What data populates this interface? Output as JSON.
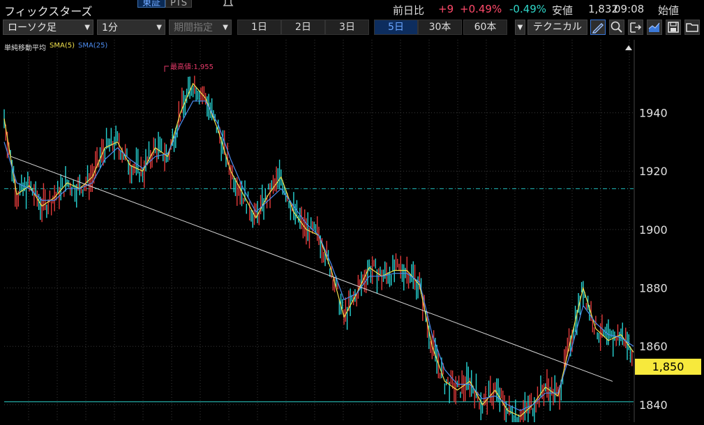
{
  "header": {
    "title": "フィックスターズ",
    "exchange_tabs": [
      "東証",
      "PTS"
    ],
    "quote": {
      "prev_label": "前日比",
      "change": "+9",
      "change_pct": "+0.49%",
      "other_pct": "-0.49%",
      "low_label": "安値",
      "low_value": "1,832",
      "time": "09:08",
      "open_label": "始値"
    }
  },
  "toolbar": {
    "chart_type": "ローソク足",
    "interval": "1分",
    "date_range": "期間指定",
    "periods": [
      "1日",
      "2日",
      "3日",
      "5日",
      "30本",
      "60本"
    ],
    "active_period": "5日",
    "technical": "テクニカル"
  },
  "legend": {
    "label": "単純移動平均",
    "sma5": "SMA(5)",
    "sma25": "SMA(25)"
  },
  "colors": {
    "up": "#e23b3b",
    "down": "#27d4d4",
    "sma5": "#f2e24d",
    "sma25": "#4d8cf0",
    "high_marker": "#e83a6a",
    "hline_dashed": "#1fbfbf",
    "hline_solid": "#2ad1c9",
    "trendline": "#d9d9d9",
    "price_tag": "#f7e93c",
    "grid": "#3a3a3a"
  },
  "chart_data": {
    "type": "line",
    "title": "",
    "xlabel": "",
    "ylabel": "",
    "ylim": [
      1834,
      1965
    ],
    "y_ticks": [
      1840,
      1860,
      1880,
      1900,
      1920,
      1940
    ],
    "y_tick_labels": [
      "1840",
      "1860",
      "1880",
      "1900",
      "1920",
      "1940"
    ],
    "grid": true,
    "legend_position": "top-left",
    "high_annotation": "最高値:1,955",
    "high_value": 1955,
    "current_price_label": "1,850",
    "current_price": 1850,
    "horizontal_lines": [
      {
        "value": 1914,
        "style": "dashed"
      },
      {
        "value": 1841,
        "style": "solid"
      }
    ],
    "trendline": {
      "from": [
        0,
        1925
      ],
      "to": [
        1,
        1848
      ]
    },
    "x": [
      0,
      0.02,
      0.04,
      0.06,
      0.08,
      0.1,
      0.12,
      0.14,
      0.16,
      0.18,
      0.2,
      0.22,
      0.24,
      0.26,
      0.28,
      0.3,
      0.32,
      0.34,
      0.36,
      0.38,
      0.4,
      0.42,
      0.44,
      0.46,
      0.48,
      0.5,
      0.52,
      0.54,
      0.56,
      0.58,
      0.6,
      0.62,
      0.64,
      0.66,
      0.68,
      0.7,
      0.72,
      0.74,
      0.76,
      0.78,
      0.8,
      0.82,
      0.84,
      0.86,
      0.88,
      0.9,
      0.92,
      0.94,
      0.96,
      0.98,
      1.0
    ],
    "series": [
      {
        "name": "SMA(5)",
        "values": [
          1938,
          1912,
          1915,
          1908,
          1911,
          1916,
          1914,
          1918,
          1928,
          1930,
          1922,
          1920,
          1928,
          1925,
          1940,
          1950,
          1945,
          1934,
          1920,
          1912,
          1904,
          1912,
          1918,
          1906,
          1900,
          1898,
          1886,
          1870,
          1878,
          1887,
          1884,
          1886,
          1886,
          1881,
          1860,
          1848,
          1845,
          1848,
          1840,
          1845,
          1838,
          1836,
          1840,
          1846,
          1843,
          1862,
          1880,
          1866,
          1862,
          1864,
          1858
        ]
      },
      {
        "name": "SMA(25)",
        "values": [
          1930,
          1916,
          1914,
          1910,
          1910,
          1914,
          1914,
          1916,
          1924,
          1928,
          1924,
          1921,
          1925,
          1926,
          1936,
          1944,
          1944,
          1936,
          1924,
          1914,
          1906,
          1910,
          1914,
          1908,
          1902,
          1898,
          1888,
          1876,
          1878,
          1884,
          1884,
          1885,
          1885,
          1882,
          1864,
          1852,
          1847,
          1847,
          1842,
          1843,
          1840,
          1838,
          1840,
          1844,
          1844,
          1858,
          1874,
          1868,
          1864,
          1863,
          1860
        ]
      }
    ]
  }
}
